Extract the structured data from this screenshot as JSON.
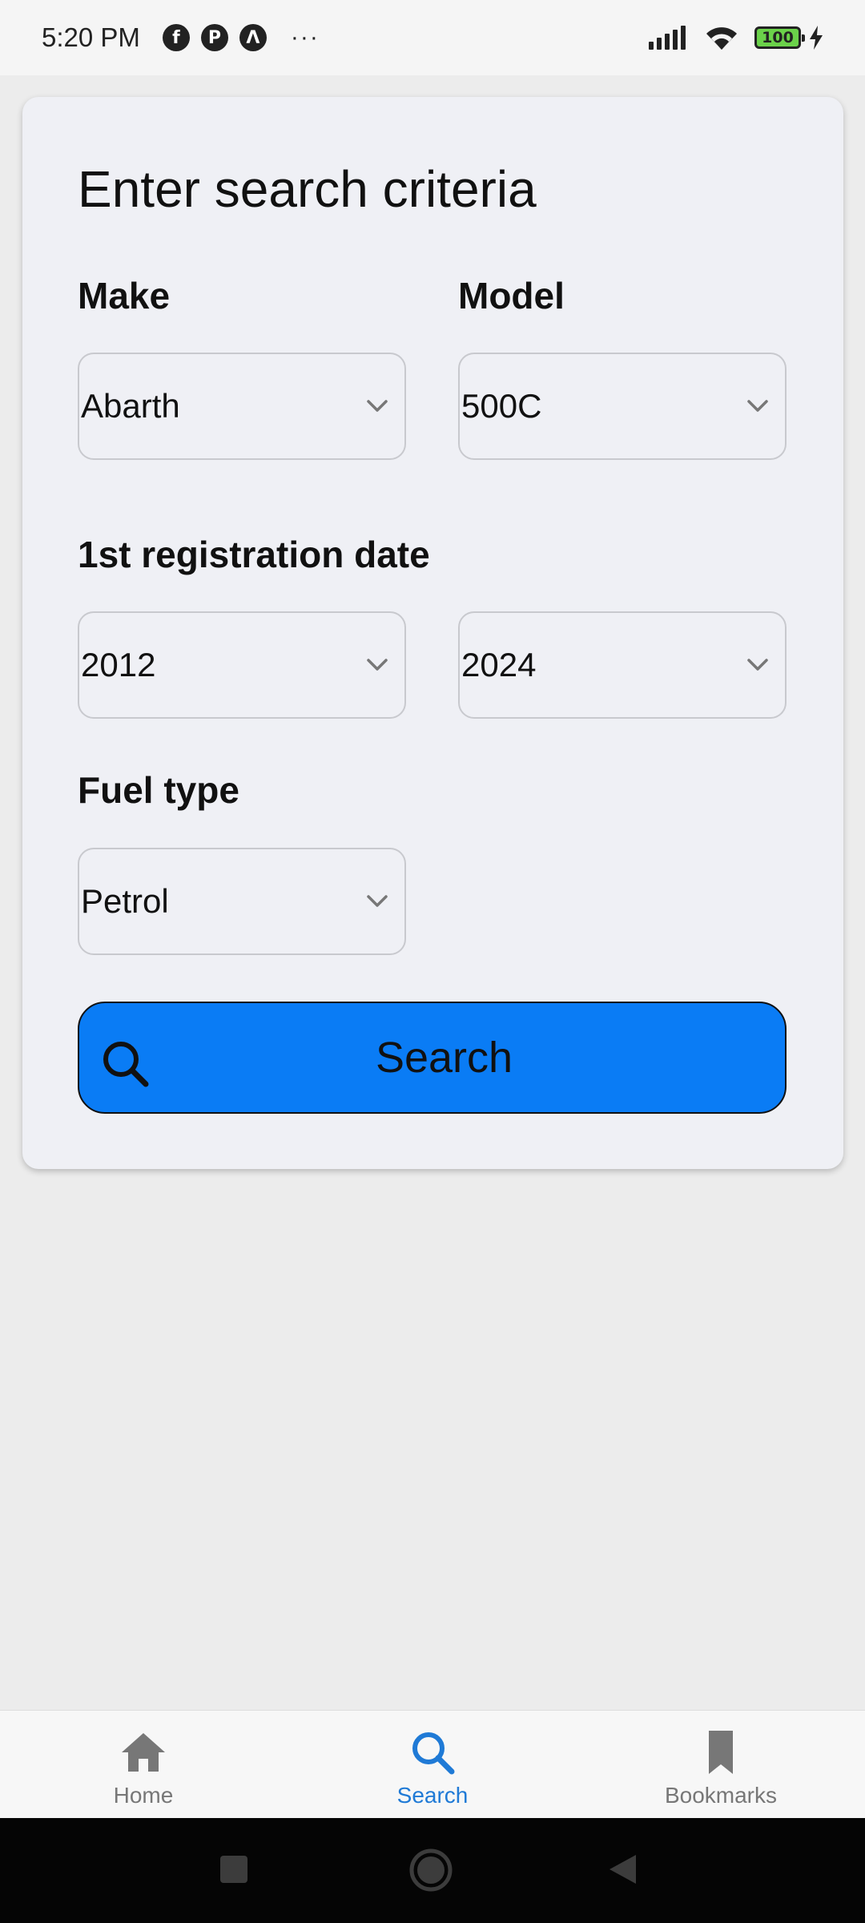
{
  "status_bar": {
    "time": "5:20 PM",
    "more": "···",
    "battery": "100",
    "app_icons": [
      "facebook-icon",
      "app-icon",
      "arc-icon"
    ]
  },
  "form": {
    "title": "Enter search criteria",
    "make": {
      "label": "Make",
      "value": "Abarth"
    },
    "model": {
      "label": "Model",
      "value": "500C"
    },
    "registration": {
      "label": "1st registration date",
      "from": "2012",
      "to": "2024"
    },
    "fuel": {
      "label": "Fuel type",
      "value": "Petrol"
    },
    "search_button": "Search"
  },
  "bottom_nav": {
    "items": [
      {
        "label": "Home",
        "icon": "home-icon",
        "active": false
      },
      {
        "label": "Search",
        "icon": "search-icon",
        "active": true
      },
      {
        "label": "Bookmarks",
        "icon": "bookmark-icon",
        "active": false
      }
    ]
  },
  "colors": {
    "accent": "#0a7cf5",
    "nav_active": "#1f7ad6",
    "nav_inactive": "#777777",
    "card_background": "#eff0f5"
  }
}
